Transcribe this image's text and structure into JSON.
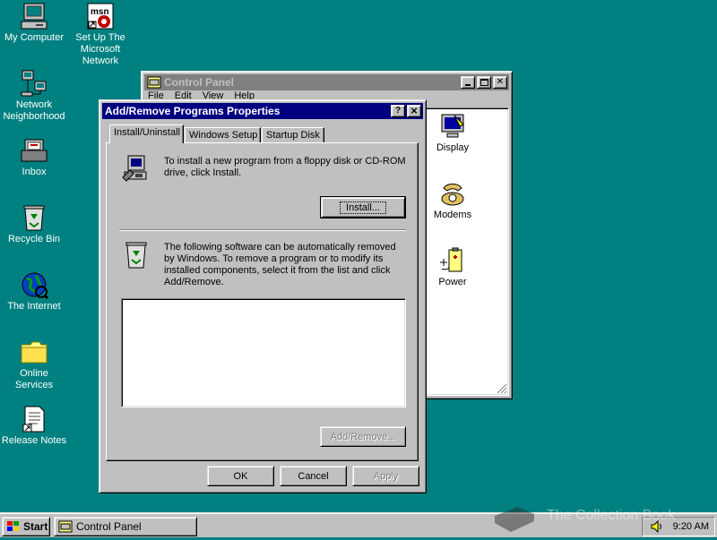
{
  "colors": {
    "desktop": "#008080",
    "face": "#c0c0c0",
    "title_active": "#000080",
    "title_inactive": "#808080"
  },
  "desktop_icons": [
    {
      "label": "My Computer",
      "icon": "computer-icon"
    },
    {
      "label": "Set Up The Microsoft Network",
      "icon": "msn-icon"
    },
    {
      "label": "Network Neighborhood",
      "icon": "network-icon"
    },
    {
      "label": "Inbox",
      "icon": "inbox-icon"
    },
    {
      "label": "Recycle Bin",
      "icon": "recycle-bin-icon"
    },
    {
      "label": "The Internet",
      "icon": "internet-globe-icon"
    },
    {
      "label": "Online Services",
      "icon": "folder-icon"
    },
    {
      "label": "Release Notes",
      "icon": "document-shortcut-icon"
    }
  ],
  "control_panel": {
    "title": "Control Panel",
    "menu": [
      "File",
      "Edit",
      "View",
      "Help"
    ],
    "items": [
      {
        "label": "Display",
        "icon": "display-icon"
      },
      {
        "label": "Modems",
        "icon": "modem-phone-icon"
      },
      {
        "label": "Power",
        "icon": "power-icon"
      }
    ]
  },
  "dialog": {
    "title": "Add/Remove Programs Properties",
    "help_glyph": "?",
    "close_glyph": "×",
    "tabs": [
      "Install/Uninstall",
      "Windows Setup",
      "Startup Disk"
    ],
    "selected_tab": 0,
    "install_text": "To install a new program from a floppy disk or CD-ROM drive, click Install.",
    "install_button": "Install...",
    "remove_text": "The following software can be automatically removed by Windows. To remove a program or to modify its installed components, select it from the list and click Add/Remove.",
    "programs": [],
    "add_remove_button": "Add/Remove...",
    "ok_button": "OK",
    "cancel_button": "Cancel",
    "apply_button": "Apply"
  },
  "taskbar": {
    "start_label": "Start",
    "task_label": "Control Panel",
    "clock": "9:20 AM",
    "tray_icon": "speaker-icon"
  },
  "watermark": "The Collection Book"
}
